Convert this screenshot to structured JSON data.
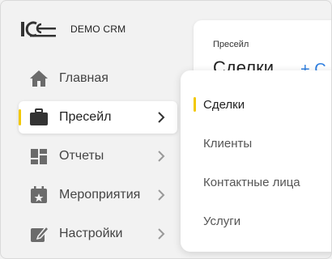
{
  "app": {
    "name": "DEMO CRM",
    "logo": "1С",
    "accent": "#f2c800",
    "link_color": "#2f7fe0"
  },
  "sidebar": {
    "items": [
      {
        "label": "Главная",
        "icon": "home-icon",
        "active": false,
        "has_submenu": false
      },
      {
        "label": "Пресейл",
        "icon": "briefcase-icon",
        "active": true,
        "has_submenu": true
      },
      {
        "label": "Отчеты",
        "icon": "dashboard-icon",
        "active": false,
        "has_submenu": true
      },
      {
        "label": "Мероприятия",
        "icon": "calendar-star-icon",
        "active": false,
        "has_submenu": true
      },
      {
        "label": "Настройки",
        "icon": "edit-settings-icon",
        "active": false,
        "has_submenu": true
      }
    ]
  },
  "content": {
    "breadcrumb": "Пресейл",
    "title": "Сделки",
    "add_label": "+ С"
  },
  "submenu": {
    "items": [
      {
        "label": "Сделки",
        "active": true
      },
      {
        "label": "Клиенты",
        "active": false
      },
      {
        "label": "Контактные лица",
        "active": false
      },
      {
        "label": "Услуги",
        "active": false
      }
    ]
  }
}
